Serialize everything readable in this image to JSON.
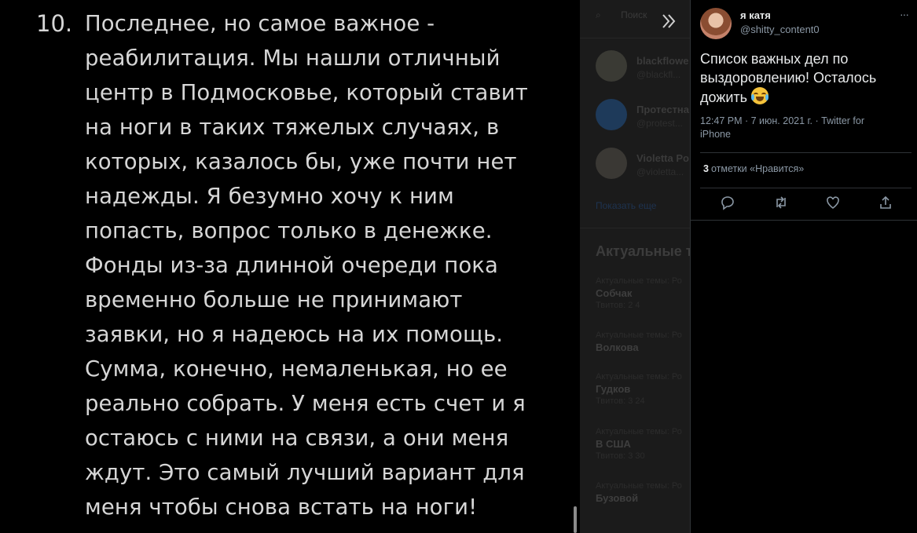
{
  "note": {
    "number": "10.",
    "lines": [
      "Последнее, но самое важное -",
      "реабилитация. Мы нашли отличный",
      "центр в Подмосковье, который ставит",
      "на ноги в таких тяжелых случаях, в",
      "которых, казалось бы, уже почти нет",
      "надежды. Я безумно хочу к ним",
      "попасть, вопрос только в денежке.",
      "Фонды из-за длинной очереди пока",
      "временно больше не принимают",
      "заявки, но я надеюсь на их помощь.",
      "Сумма, конечно, немаленькая, но ее",
      "реально собрать. У меня есть счет и я",
      "остаюсь с ними на связи, а они меня",
      "ждут. Это самый лучший вариант для",
      "меня чтобы снова встать на ноги!"
    ]
  },
  "background": {
    "top_tabs": [
      "Поиск"
    ],
    "users": [
      {
        "name": "blackflowe",
        "handle": "@blackfl..."
      },
      {
        "name": "Протестна",
        "handle": "@protest..."
      },
      {
        "name": "Violetta Po",
        "handle": "@violetta..."
      }
    ],
    "show_more": "Показать еще",
    "trends_heading": "Актуальные т",
    "trends": [
      {
        "context": "Актуальные темы: Ро",
        "title": "Собчак",
        "count": "Твитов: 2 4"
      },
      {
        "context": "Актуальные темы: Ро",
        "title": "Волкова",
        "count": ""
      },
      {
        "context": "Актуальные темы: Ро",
        "title": "Гудков",
        "count": "Твитов: 3 24"
      },
      {
        "context": "Актуальные темы: Ро",
        "title": "В США",
        "count": "Твитов: 3 30"
      },
      {
        "context": "Актуальные темы: Ро",
        "title": "Бузовой",
        "count": ""
      }
    ]
  },
  "tweet": {
    "name": "я катя",
    "handle": "@shitty_content0",
    "text_line1": "Список важных дел по",
    "text_line2": "выздоровлению! Осталось",
    "text_line3": "дожить",
    "emoji": "face-with-tears-of-joy-icon",
    "meta": "12:47 PM · 7 июн. 2021 г. · Twitter for iPhone",
    "likes_count": "3",
    "likes_label": "отметки «Нравится»",
    "menu": "···"
  }
}
